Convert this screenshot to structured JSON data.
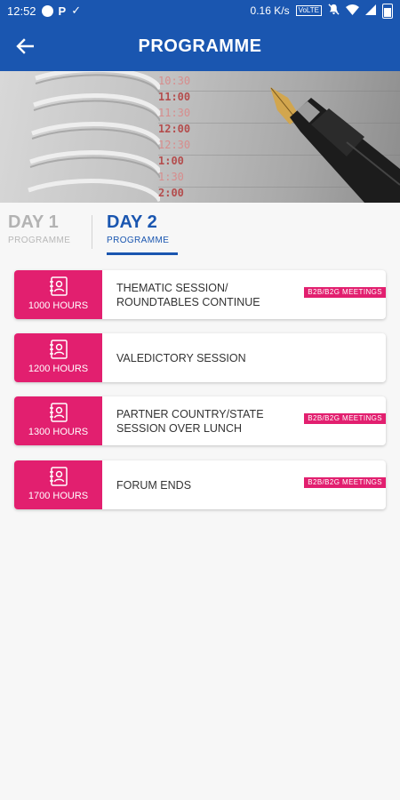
{
  "status_bar": {
    "time": "12:52",
    "net_speed": "0.16 K/s",
    "volte": "VoLTE"
  },
  "header": {
    "title": "PROGRAMME"
  },
  "banner": {
    "times": [
      "10:30",
      "11:00",
      "11:30",
      "12:00",
      "12:30",
      "1:00",
      "1:30",
      "2:00"
    ]
  },
  "tabs": [
    {
      "day": "DAY 1",
      "sub": "PROGRAMME"
    },
    {
      "day": "DAY 2",
      "sub": "PROGRAMME"
    }
  ],
  "active_tab": "DAY 2",
  "sessions": [
    {
      "time": "1000 HOURS",
      "title": "THEMATIC SESSION/ ROUNDTABLES CONTINUE",
      "tag": "B2B/B2G MEETINGS"
    },
    {
      "time": "1200 HOURS",
      "title": "VALEDICTORY SESSION",
      "tag": ""
    },
    {
      "time": "1300 HOURS",
      "title": "PARTNER COUNTRY/STATE SESSION OVER LUNCH",
      "tag": "B2B/B2G MEETINGS"
    },
    {
      "time": "1700 HOURS",
      "title": "FORUM ENDS",
      "tag": "B2B/B2G MEETINGS"
    }
  ],
  "colors": {
    "primary": "#1a56b0",
    "accent": "#e21f6f",
    "inactive_tab": "#b3b3b3"
  }
}
